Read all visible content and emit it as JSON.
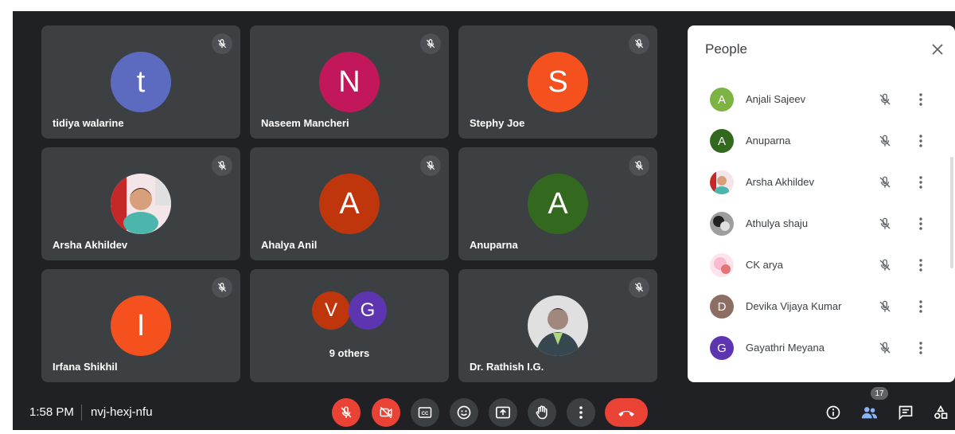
{
  "tiles": [
    {
      "name": "tidiya walarine",
      "initial": "t",
      "color": "#5c6bc0"
    },
    {
      "name": "Naseem Mancheri",
      "initial": "N",
      "color": "#c2185b"
    },
    {
      "name": "Stephy Joe",
      "initial": "S",
      "color": "#f4511e"
    },
    {
      "name": "Arsha Akhildev",
      "avatar": "photo-child"
    },
    {
      "name": "Ahalya Anil",
      "initial": "A",
      "color": "#bf360c"
    },
    {
      "name": "Anuparna",
      "initial": "A",
      "color": "#33691e"
    },
    {
      "name": "Irfana Shikhil",
      "initial": "I",
      "color": "#f4511e"
    },
    {
      "others": {
        "initials": [
          "V",
          "G"
        ],
        "colors": [
          "#bf360c",
          "#5e35b1"
        ],
        "label": "9 others"
      }
    },
    {
      "name": "Dr. Rathish I.G.",
      "avatar": "photo-man"
    }
  ],
  "people_panel": {
    "title": "People",
    "participants": [
      {
        "name": "Anjali Sajeev",
        "initial": "A",
        "color": "#7cb342"
      },
      {
        "name": "Anuparna",
        "initial": "A",
        "color": "#33691e"
      },
      {
        "name": "Arsha Akhildev",
        "avatar": "photo-child"
      },
      {
        "name": "Athulya shaju",
        "avatar": "photo-bw"
      },
      {
        "name": "CK arya",
        "avatar": "photo-pink"
      },
      {
        "name": "Devika Vijaya Kumar",
        "initial": "D",
        "color": "#8d6e63"
      },
      {
        "name": "Gayathri Meyana",
        "initial": "G",
        "color": "#5e35b1"
      }
    ]
  },
  "bottom_bar": {
    "time": "1:58 PM",
    "meeting_code": "nvj-hexj-nfu",
    "people_count": "17"
  },
  "colors": {
    "background": "#202124",
    "tile": "#3c4043",
    "danger": "#ea4335"
  }
}
